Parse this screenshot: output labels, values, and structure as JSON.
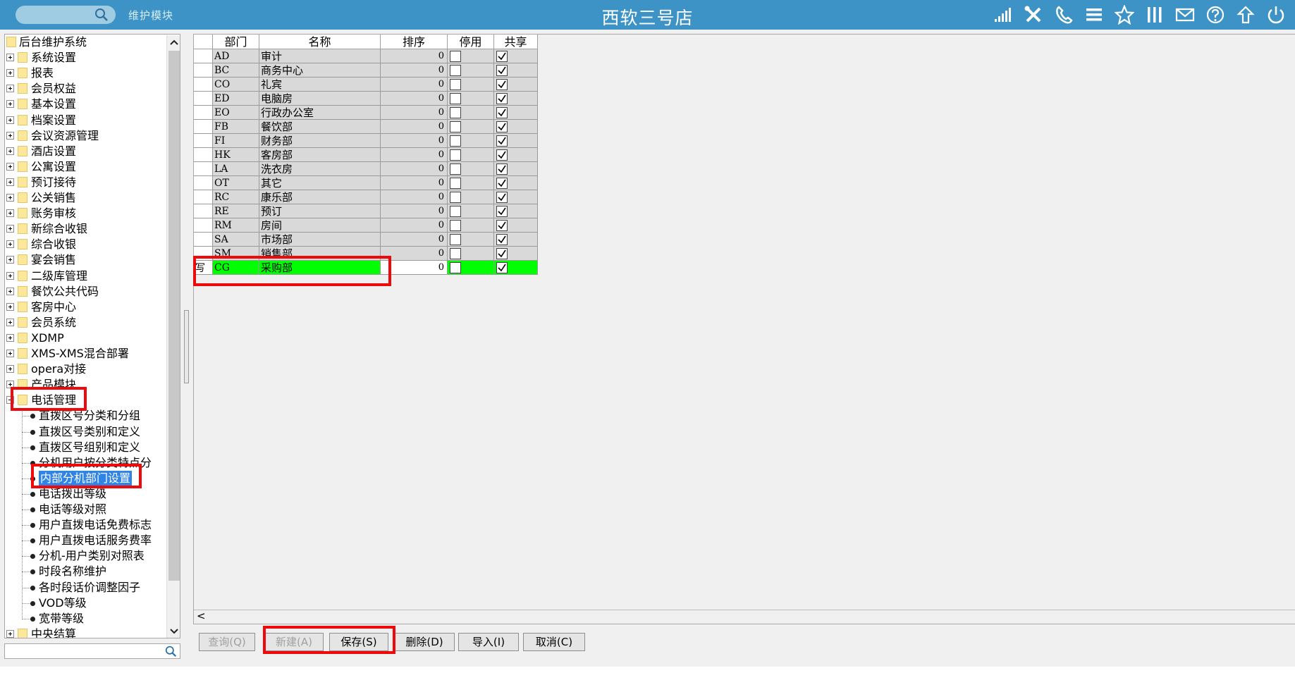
{
  "topbar": {
    "module_label": "维护模块",
    "title": "西软三号店",
    "icons": [
      "signal-icon",
      "tools-icon",
      "phone-icon",
      "menu-icon",
      "star-icon",
      "columns-icon",
      "mail-icon",
      "help-icon",
      "upload-icon",
      "power-icon"
    ]
  },
  "tree": {
    "root": "后台维护系统",
    "folders": [
      "系统设置",
      "报表",
      "会员权益",
      "基本设置",
      "档案设置",
      "会议资源管理",
      "酒店设置",
      "公寓设置",
      "预订接待",
      "公关销售",
      "账务审核",
      "新综合收银",
      "综合收银",
      "宴会销售",
      "二级库管理",
      "餐饮公共代码",
      "客房中心",
      "会员系统",
      "XDMP",
      "XMS-XMS混合部署",
      "opera对接",
      "产品模块"
    ],
    "expanded_folder": "电话管理",
    "leaves": [
      "直拨区号分类和分组",
      "直拨区号类别和定义",
      "直拨区号组别和定义",
      "分机用户按分类特点分",
      "内部分机部门设置",
      "电话拨出等级",
      "电话等级对照",
      "用户直拨电话免费标志",
      "用户直拨电话服务费率",
      "分机-用户类别对照表",
      "时段名称维护",
      "各时段话价调整因子",
      "VOD等级",
      "宽带等级"
    ],
    "selected_leaf": "内部分机部门设置",
    "last_folder": "中央结算",
    "search_placeholder": ""
  },
  "grid": {
    "columns": [
      "部门",
      "名称",
      "排序",
      "停用",
      "共享"
    ],
    "rows": [
      {
        "code": "AD",
        "name": "审计",
        "order": "0",
        "disabled": false,
        "shared": true
      },
      {
        "code": "BC",
        "name": "商务中心",
        "order": "0",
        "disabled": false,
        "shared": true
      },
      {
        "code": "CO",
        "name": "礼宾",
        "order": "0",
        "disabled": false,
        "shared": true
      },
      {
        "code": "ED",
        "name": "电脑房",
        "order": "0",
        "disabled": false,
        "shared": true
      },
      {
        "code": "EO",
        "name": "行政办公室",
        "order": "0",
        "disabled": false,
        "shared": true
      },
      {
        "code": "FB",
        "name": "餐饮部",
        "order": "0",
        "disabled": false,
        "shared": true
      },
      {
        "code": "FI",
        "name": "财务部",
        "order": "0",
        "disabled": false,
        "shared": true
      },
      {
        "code": "HK",
        "name": "客房部",
        "order": "0",
        "disabled": false,
        "shared": true
      },
      {
        "code": "LA",
        "name": "洗衣房",
        "order": "0",
        "disabled": false,
        "shared": true
      },
      {
        "code": "OT",
        "name": "其它",
        "order": "0",
        "disabled": false,
        "shared": true
      },
      {
        "code": "RC",
        "name": "康乐部",
        "order": "0",
        "disabled": false,
        "shared": true
      },
      {
        "code": "RE",
        "name": "预订",
        "order": "0",
        "disabled": false,
        "shared": true
      },
      {
        "code": "RM",
        "name": "房间",
        "order": "0",
        "disabled": false,
        "shared": true
      },
      {
        "code": "SA",
        "name": "市场部",
        "order": "0",
        "disabled": false,
        "shared": true
      },
      {
        "code": "SM",
        "name": "销售部",
        "order": "0",
        "disabled": false,
        "shared": true
      },
      {
        "code": "CG",
        "name": "采购部",
        "order": "0",
        "disabled": false,
        "shared": true
      }
    ],
    "new_row_indicator": "写",
    "hscroll_arrow": "<"
  },
  "buttons": {
    "query": "查询(Q)",
    "new": "新建(A)",
    "save": "保存(S)",
    "delete": "删除(D)",
    "import": "导入(I)",
    "cancel": "取消(C)"
  },
  "colors": {
    "topbar": "#3d93c5",
    "selected_row": "#00ff00",
    "highlight_box": "#ee0a0a",
    "selected_leaf": "#2f84e6",
    "row_fill": "#d9d9d9"
  }
}
